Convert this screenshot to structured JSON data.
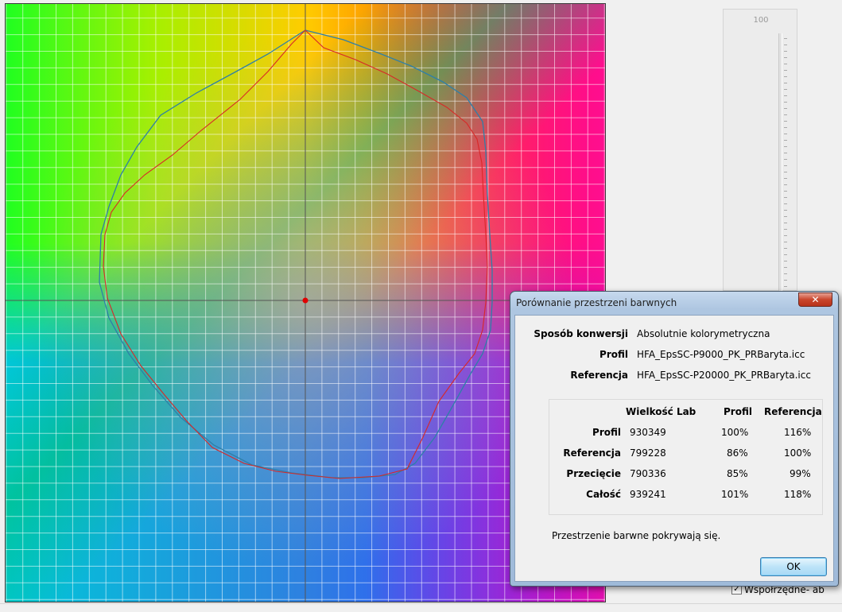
{
  "plot": {
    "grid_color": "#ffffff",
    "axis_color": "#555555",
    "profile_curve_color": "#2e7fa8",
    "reference_curve_color": "#d82828",
    "center_marker_color": "#e00000"
  },
  "slider": {
    "max_label": "100"
  },
  "checkbox": {
    "label": "Współrzędne- ab",
    "checked": true
  },
  "dialog": {
    "title": "Porównanie przestrzeni barwnych",
    "close_label": "✕",
    "info": [
      {
        "label": "Sposób konwersji",
        "value": "Absolutnie kolorymetryczna"
      },
      {
        "label": "Profil",
        "value": "HFA_EpsSC-P9000_PK_PRBaryta.icc"
      },
      {
        "label": "Referencja",
        "value": "HFA_EpsSC-P20000_PK_PRBaryta.icc"
      }
    ],
    "table": {
      "headers": {
        "lab": "Wielkość Lab",
        "profil": "Profil",
        "ref": "Referencja"
      },
      "rows": [
        {
          "label": "Profil",
          "lab": "930349",
          "profil": "100%",
          "ref": "116%"
        },
        {
          "label": "Referencja",
          "lab": "799228",
          "profil": "86%",
          "ref": "100%"
        },
        {
          "label": "Przecięcie",
          "lab": "790336",
          "profil": "85%",
          "ref": "99%"
        },
        {
          "label": "Całość",
          "lab": "939241",
          "profil": "101%",
          "ref": "118%"
        }
      ]
    },
    "message": "Przestrzenie barwne pokrywają się.",
    "ok_label": "OK"
  }
}
